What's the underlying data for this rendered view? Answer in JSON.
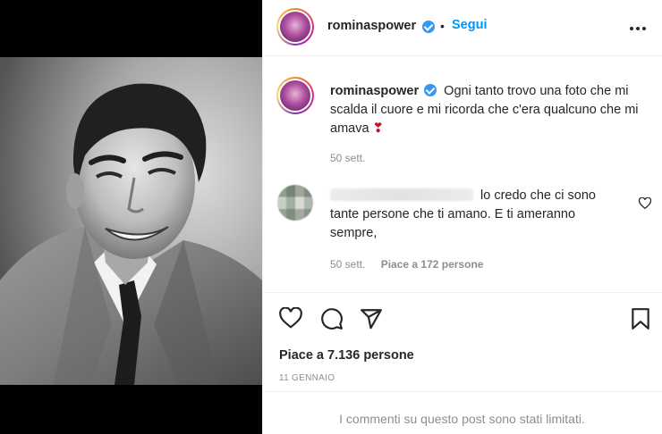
{
  "post": {
    "username": "rominaspower",
    "follow_label": "Segui",
    "separator": "•",
    "more_label": "•••",
    "caption": {
      "username": "rominaspower",
      "text": "Ogni tanto trovo una foto che mi scalda il cuore e mi ricorda che c'era qualcuno che mi amava",
      "emoji": "❣",
      "time": "50 sett."
    },
    "comment": {
      "text": "lo credo che ci sono tante persone che ti amano. E ti ameranno sempre,",
      "time": "50 sett.",
      "likes": "Piace a 172 persone"
    },
    "likes": "Piace a 7.136 persone",
    "date": "11 GENNAIO",
    "limited_notice": "I commenti su questo post sono stati limitati."
  },
  "colors": {
    "link_blue": "#0095f6",
    "verified_blue": "#3897f0",
    "text": "#262626",
    "muted": "#8e8e8e",
    "emoji_red": "#c8102e"
  },
  "icons": {
    "like": "heart-icon",
    "comment": "comment-icon",
    "share": "share-icon",
    "save": "bookmark-icon",
    "comment_like": "heart-icon",
    "verified": "verified-badge-icon",
    "more": "more-options-icon"
  }
}
